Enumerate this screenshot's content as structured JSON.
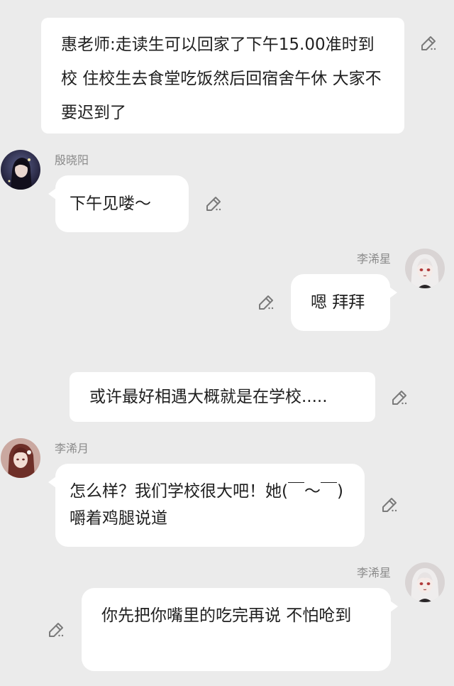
{
  "chat": {
    "narration": [
      {
        "text": "惠老师:走读生可以回家了下午15.00准时到校 住校生去食堂吃饭然后回宿舍午休 大家不要迟到了"
      },
      {
        "text": "或许最好相遇大概就是在学校....."
      }
    ],
    "messages": [
      {
        "sender": "殷晓阳",
        "text": "下午见喽～",
        "side": "left"
      },
      {
        "sender": "李浠星",
        "text": "嗯 拜拜",
        "side": "right"
      },
      {
        "sender": "李浠月",
        "text": "怎么样？我们学校很大吧！她(￣～￣)嚼着鸡腿说道",
        "side": "left"
      },
      {
        "sender": "李浠星",
        "text": "你先把你嘴里的吃完再说 不怕呛到",
        "side": "right"
      }
    ],
    "icons": {
      "edit": "pencil-edit-icon",
      "avatar": "avatar-image"
    },
    "colors": {
      "background": "#ebebeb",
      "bubble": "#ffffff",
      "text": "#1f1f1f",
      "name": "#8a8a8a",
      "icon": "#7a7a7a"
    }
  }
}
